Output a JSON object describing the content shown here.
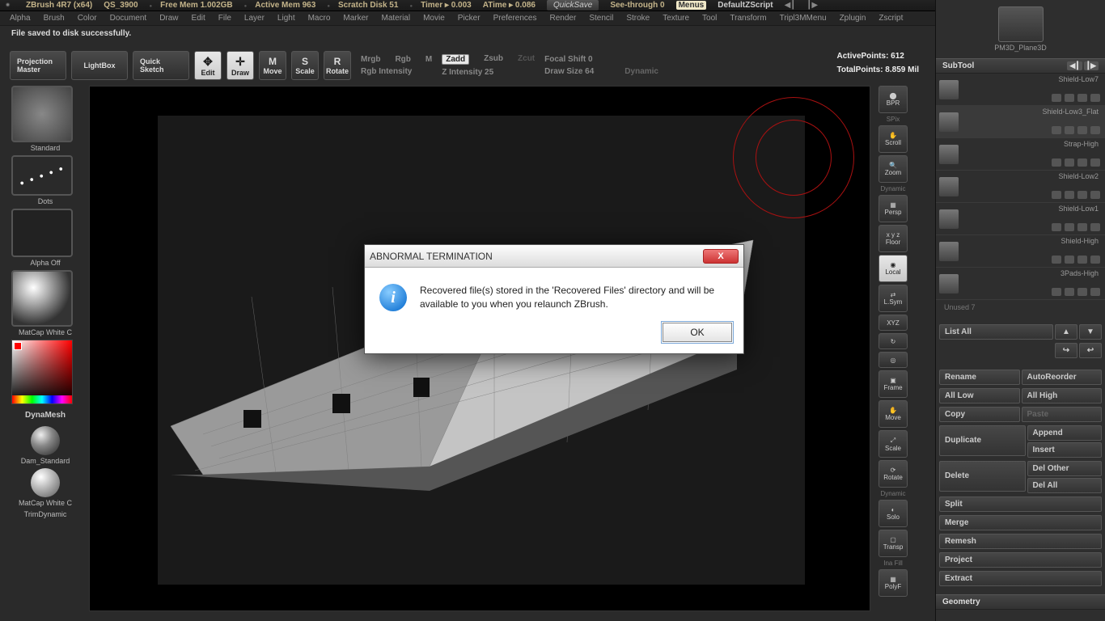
{
  "top": {
    "app": "ZBrush 4R7 (x64)",
    "project": "QS_3900",
    "freemem": "Free Mem 1.002GB",
    "activemem": "Active Mem 963",
    "scratch": "Scratch Disk 51",
    "timer": "Timer ▸ 0.003",
    "atime": "ATime ▸ 0.086",
    "quicksave": "QuickSave",
    "seethrough": "See-through   0",
    "menus": "Menus",
    "defaultzscript": "DefaultZScript"
  },
  "menu": [
    "Alpha",
    "Brush",
    "Color",
    "Document",
    "Draw",
    "Edit",
    "File",
    "Layer",
    "Light",
    "Macro",
    "Marker",
    "Material",
    "Movie",
    "Picker",
    "Preferences",
    "Render",
    "Stencil",
    "Stroke",
    "Texture",
    "Tool",
    "Transform",
    "Tripl3MMenu",
    "Zplugin",
    "Zscript"
  ],
  "status": "File saved to disk successfully.",
  "shelf": {
    "projection": "Projection Master",
    "lightbox": "LightBox",
    "quicksketch": "Quick Sketch",
    "edit": "Edit",
    "draw": "Draw",
    "move": "Move",
    "scale": "Scale",
    "rotate": "Rotate",
    "mrgb": "Mrgb",
    "rgb": "Rgb",
    "m": "M",
    "rgbint": "Rgb Intensity",
    "zadd": "Zadd",
    "zsub": "Zsub",
    "zcut": "Zcut",
    "zint": "Z Intensity 25",
    "focal": "Focal Shift 0",
    "drawsize": "Draw Size 64",
    "dynamic": "Dynamic",
    "activepoints": "ActivePoints: 612",
    "totalpoints": "TotalPoints: 8.859 Mil"
  },
  "left": {
    "brush": "Standard",
    "stroke": "Dots",
    "alpha": "Alpha Off",
    "material": "MatCap White C",
    "dynamesh": "DynaMesh",
    "dam": "Dam_Standard",
    "mat2": "MatCap White C",
    "trim": "TrimDynamic"
  },
  "nav": {
    "bpr": "BPR",
    "spix": "SPix",
    "scroll": "Scroll",
    "zoom": "Zoom",
    "persp": "Persp",
    "floor": "Floor",
    "local": "Local",
    "lsym": "L.Sym",
    "xyz": "XYZ",
    "frame": "Frame",
    "move": "Move",
    "scale": "Scale",
    "rotate": "Rotate",
    "solo": "Solo",
    "transp": "Transp",
    "polyf": "PolyF",
    "dyn": "Dynamic",
    "inefill": "Ina Fill"
  },
  "right": {
    "toolname": "PM3D_Plane3D",
    "subtool_hdr": "SubTool",
    "subtools": [
      "Shield-Low7",
      "Shield-Low3_Flat",
      "Strap-High",
      "Shield-Low2",
      "Shield-Low1",
      "Shield-High",
      "3Pads-High"
    ],
    "unused": "Unused 7",
    "listall": "List All",
    "rename": "Rename",
    "autoreorder": "AutoReorder",
    "alllow": "All Low",
    "allhigh": "All High",
    "copy": "Copy",
    "paste": "Paste",
    "duplicate": "Duplicate",
    "append": "Append",
    "insert": "Insert",
    "delete": "Delete",
    "delother": "Del Other",
    "delall": "Del All",
    "split": "Split",
    "merge": "Merge",
    "remesh": "Remesh",
    "project": "Project",
    "extract": "Extract",
    "geometry": "Geometry"
  },
  "dialog": {
    "title": "ABNORMAL TERMINATION",
    "message": "Recovered file(s) stored in the 'Recovered Files' directory and will be available to you when you relaunch ZBrush.",
    "ok": "OK"
  }
}
